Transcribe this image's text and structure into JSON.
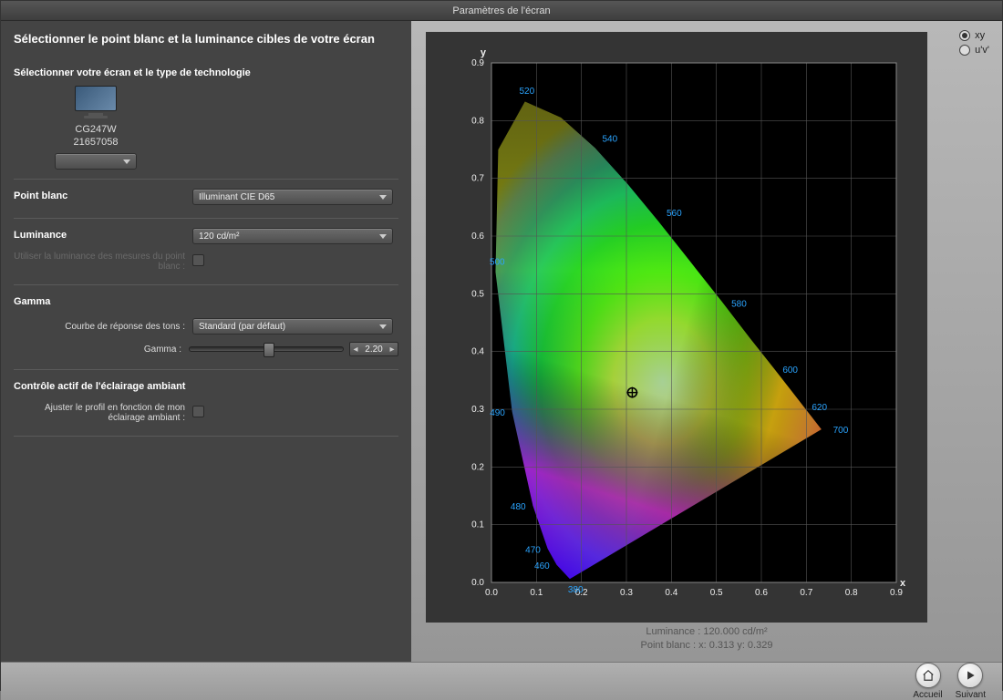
{
  "titlebar": "Paramètres de l'écran",
  "left": {
    "heading": "Sélectionner le point blanc et la luminance cibles de votre écran",
    "tech_heading": "Sélectionner votre écran et le type de technologie",
    "monitor_model": "CG247W",
    "monitor_serial": "21657058",
    "whitepoint_label": "Point blanc",
    "whitepoint_value": "Illuminant CIE D65",
    "luminance_label": "Luminance",
    "luminance_value": "120 cd/m²",
    "luminance_use_measure": "Utiliser la luminance des mesures du point blanc :",
    "gamma_heading": "Gamma",
    "tone_curve_label": "Courbe de réponse des tons :",
    "tone_curve_value": "Standard (par défaut)",
    "gamma_label": "Gamma :",
    "gamma_value": "2.20",
    "ambient_heading": "Contrôle actif de l'éclairage ambiant",
    "ambient_adjust_label": "Ajuster le profil en fonction de mon éclairage ambiant :"
  },
  "right": {
    "toggle_xy": "xy",
    "toggle_uv": "u'v'",
    "luminance_readout": "Luminance : 120.000 cd/m²",
    "whitepoint_readout": "Point blanc : x: 0.313  y: 0.329"
  },
  "footer": {
    "home": "Accueil",
    "next": "Suivant"
  },
  "chart_data": {
    "type": "area",
    "title": "",
    "xlabel": "x",
    "ylabel": "y",
    "xlim": [
      0.0,
      0.9
    ],
    "ylim": [
      0.0,
      0.9
    ],
    "xticks": [
      0.0,
      0.1,
      0.2,
      0.3,
      0.4,
      0.5,
      0.6,
      0.7,
      0.8,
      0.9
    ],
    "yticks": [
      0.0,
      0.1,
      0.2,
      0.3,
      0.4,
      0.5,
      0.6,
      0.7,
      0.8,
      0.9
    ],
    "marker": {
      "label": "Point blanc",
      "x": 0.313,
      "y": 0.329
    },
    "wavelength_labels_nm": [
      380,
      460,
      470,
      480,
      490,
      500,
      520,
      540,
      560,
      580,
      600,
      620,
      700
    ],
    "spectral_locus": [
      {
        "nm": 380,
        "x": 0.174,
        "y": 0.005
      },
      {
        "nm": 460,
        "x": 0.144,
        "y": 0.03
      },
      {
        "nm": 470,
        "x": 0.124,
        "y": 0.058
      },
      {
        "nm": 480,
        "x": 0.091,
        "y": 0.133
      },
      {
        "nm": 490,
        "x": 0.045,
        "y": 0.295
      },
      {
        "nm": 500,
        "x": 0.008,
        "y": 0.538
      },
      {
        "nm": 510,
        "x": 0.014,
        "y": 0.75
      },
      {
        "nm": 520,
        "x": 0.074,
        "y": 0.834
      },
      {
        "nm": 530,
        "x": 0.155,
        "y": 0.806
      },
      {
        "nm": 540,
        "x": 0.23,
        "y": 0.754
      },
      {
        "nm": 550,
        "x": 0.302,
        "y": 0.692
      },
      {
        "nm": 560,
        "x": 0.373,
        "y": 0.625
      },
      {
        "nm": 570,
        "x": 0.444,
        "y": 0.555
      },
      {
        "nm": 580,
        "x": 0.513,
        "y": 0.487
      },
      {
        "nm": 590,
        "x": 0.575,
        "y": 0.424
      },
      {
        "nm": 600,
        "x": 0.627,
        "y": 0.373
      },
      {
        "nm": 610,
        "x": 0.666,
        "y": 0.334
      },
      {
        "nm": 620,
        "x": 0.692,
        "y": 0.308
      },
      {
        "nm": 640,
        "x": 0.72,
        "y": 0.28
      },
      {
        "nm": 700,
        "x": 0.735,
        "y": 0.265
      }
    ]
  }
}
